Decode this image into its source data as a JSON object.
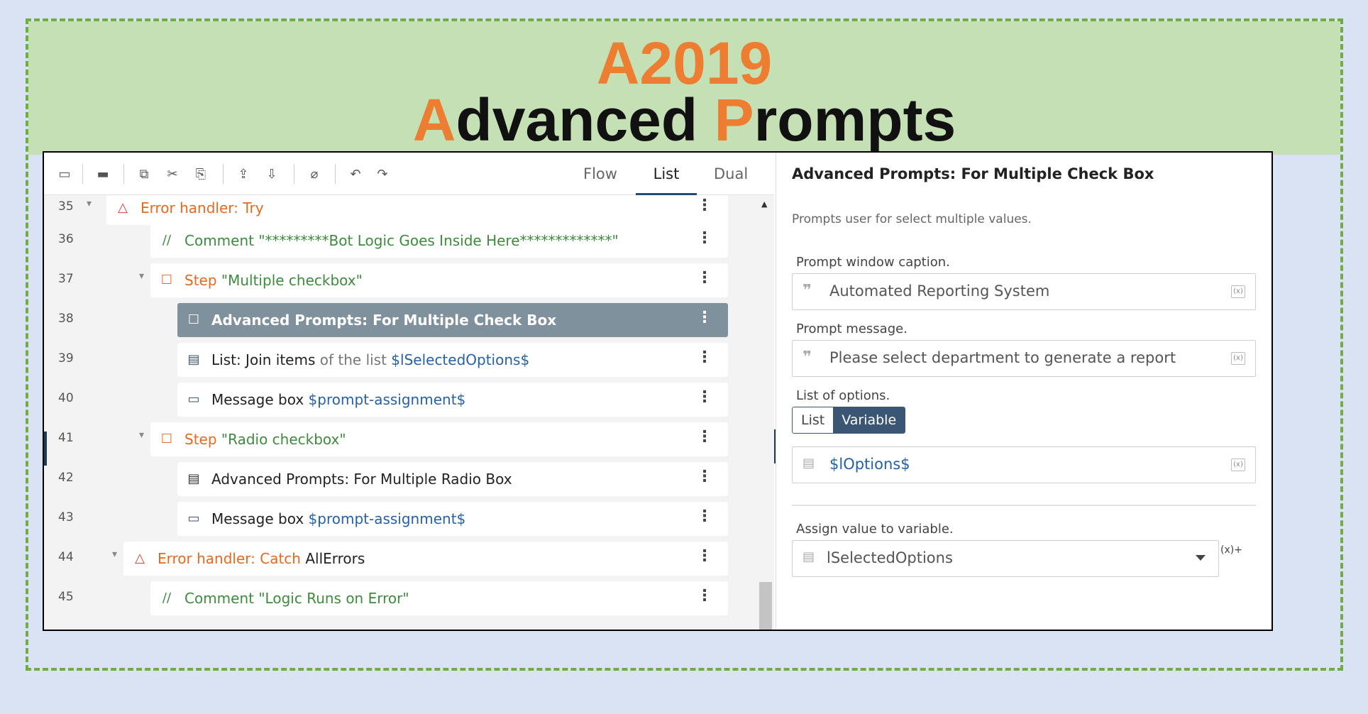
{
  "banner": {
    "line1": "A2019",
    "line2_first": "A",
    "line2_mid": "dvanced ",
    "line2_p": "P",
    "line2_rest": "rompts"
  },
  "toolbar": {
    "view_tabs": [
      "Flow",
      "List",
      "Dual"
    ],
    "active_tab": "List"
  },
  "rows": [
    {
      "num": "35",
      "parts": [
        [
          "kw-orange",
          "Error handler: Try"
        ]
      ],
      "icon": "warning-triangle-icon",
      "glyph": "△",
      "glyph_color": "#e23b2e"
    },
    {
      "num": "36",
      "parts": [
        [
          "kw-green",
          "Comment "
        ],
        [
          "kw-green",
          "\"*********Bot Logic Goes Inside Here*************\""
        ]
      ],
      "icon": "comment-icon",
      "glyph": "//",
      "glyph_color": "#3d8b3d"
    },
    {
      "num": "37",
      "parts": [
        [
          "kw-orange",
          "Step "
        ],
        [
          "kw-green",
          "\"Multiple checkbox\""
        ]
      ],
      "icon": "step-box-icon",
      "glyph": "☐",
      "glyph_color": "#e8681f"
    },
    {
      "num": "38",
      "parts": [
        [
          "",
          "Advanced Prompts: For Multiple Check Box"
        ]
      ],
      "icon": "checkbox-icon",
      "glyph": "☐",
      "glyph_color": "#ffffff",
      "selected": true
    },
    {
      "num": "39",
      "parts": [
        [
          "dark",
          "List: Join items "
        ],
        [
          "kw-gray",
          "of the list "
        ],
        [
          "kw-blue",
          "$lSelectedOptions$"
        ]
      ],
      "icon": "list-icon",
      "glyph": "▤",
      "glyph_color": "#3b5575"
    },
    {
      "num": "40",
      "parts": [
        [
          "dark",
          "Message box "
        ],
        [
          "kw-blue",
          "$prompt-assignment$"
        ]
      ],
      "icon": "message-box-icon",
      "glyph": "▭",
      "glyph_color": "#3b5575"
    },
    {
      "num": "41",
      "parts": [
        [
          "kw-orange",
          "Step "
        ],
        [
          "kw-green",
          "\"Radio checkbox\""
        ]
      ],
      "icon": "step-box-icon",
      "glyph": "☐",
      "glyph_color": "#e8681f"
    },
    {
      "num": "42",
      "parts": [
        [
          "dark",
          "Advanced Prompts: For Multiple Radio Box"
        ]
      ],
      "icon": "document-icon",
      "glyph": "▤",
      "glyph_color": "#333333"
    },
    {
      "num": "43",
      "parts": [
        [
          "dark",
          "Message box "
        ],
        [
          "kw-blue",
          "$prompt-assignment$"
        ]
      ],
      "icon": "message-box-icon",
      "glyph": "▭",
      "glyph_color": "#3b5575"
    },
    {
      "num": "44",
      "parts": [
        [
          "kw-orange",
          "Error handler: Catch "
        ],
        [
          "dark",
          "AllErrors"
        ]
      ],
      "icon": "warning-triangle-icon",
      "glyph": "△",
      "glyph_color": "#e23b2e"
    },
    {
      "num": "45",
      "parts": [
        [
          "kw-green",
          "Comment "
        ],
        [
          "kw-green",
          "\"Logic Runs on Error\""
        ]
      ],
      "icon": "comment-icon",
      "glyph": "//",
      "glyph_color": "#3d8b3d"
    }
  ],
  "panel": {
    "title": "Advanced Prompts: For Multiple Check Box",
    "description": "Prompts user for select multiple values.",
    "caption_label": "Prompt window caption.",
    "caption_value": "Automated Reporting System",
    "message_label": "Prompt message.",
    "message_value": "Please select department to generate a report",
    "options_label": "List of options.",
    "toggle_list": "List",
    "toggle_variable": "Variable",
    "options_value": "$lOptions$",
    "assign_label": "Assign value to variable.",
    "assign_value": "lSelectedOptions",
    "var_btn": "(x)",
    "side_var": "(x)+"
  }
}
